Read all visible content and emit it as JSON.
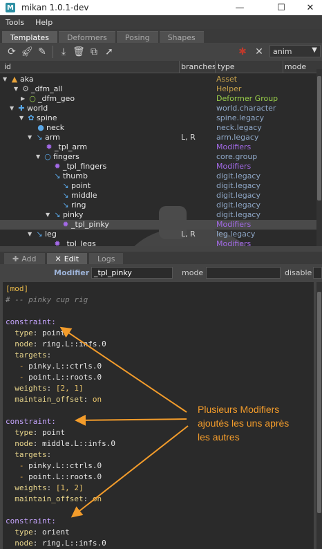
{
  "window": {
    "title": "mikan 1.0.1-dev",
    "minimize": "—",
    "maximize": "☐",
    "close": "✕",
    "app_icon": "M"
  },
  "menu": [
    "Tools",
    "Help"
  ],
  "tabs": [
    "Templates",
    "Deformers",
    "Posing",
    "Shapes"
  ],
  "toolbar": {
    "icons": [
      "refresh-icon",
      "rocket-icon",
      "brush-icon",
      "import-icon",
      "trash-icon",
      "duplicate-icon",
      "cursor-icon"
    ],
    "right_icons": [
      "bug-icon",
      "tools-icon"
    ],
    "mode_value": "anim"
  },
  "tree": {
    "columns": [
      "id",
      "branches",
      "type",
      "mode"
    ],
    "rows": [
      {
        "name": "aka",
        "branches": "",
        "type": "Asset",
        "icon": "▲",
        "icon_color": "#e8a33a",
        "type_color": "#c8a24a"
      },
      {
        "name": "_dfm_all",
        "branches": "",
        "type": "Helper",
        "icon": "⚙",
        "icon_color": "#bbbbbb",
        "type_color": "#c8a24a"
      },
      {
        "name": "_dfm_geo",
        "branches": "",
        "type": "Deformer Group",
        "icon": "○",
        "icon_color": "#9ad04a",
        "type_color": "#9ad04a"
      },
      {
        "name": "world",
        "branches": "",
        "type": "world.character",
        "icon": "✚",
        "icon_color": "#5aa8e8",
        "type_color": "#8fa8c8"
      },
      {
        "name": "spine",
        "branches": "",
        "type": "spine.legacy",
        "icon": "✿",
        "icon_color": "#5aa8e8",
        "type_color": "#8fa8c8"
      },
      {
        "name": "neck",
        "branches": "",
        "type": "neck.legacy",
        "icon": "●",
        "icon_color": "#5aa8e8",
        "type_color": "#8fa8c8"
      },
      {
        "name": "arm",
        "branches": "L, R",
        "type": "arm.legacy",
        "icon": "↘",
        "icon_color": "#5aa8e8",
        "type_color": "#8fa8c8"
      },
      {
        "name": "_tpl_arm",
        "branches": "",
        "type": "Modifiers",
        "icon": "✹",
        "icon_color": "#a46ae8",
        "type_color": "#a46ae8"
      },
      {
        "name": "fingers",
        "branches": "",
        "type": "core.group",
        "icon": "○",
        "icon_color": "#5aa8e8",
        "type_color": "#8fa8c8"
      },
      {
        "name": "_tpl_fingers",
        "branches": "",
        "type": "Modifiers",
        "icon": "✹",
        "icon_color": "#a46ae8",
        "type_color": "#a46ae8"
      },
      {
        "name": "thumb",
        "branches": "",
        "type": "digit.legacy",
        "icon": "↘",
        "icon_color": "#5aa8e8",
        "type_color": "#8fa8c8"
      },
      {
        "name": "point",
        "branches": "",
        "type": "digit.legacy",
        "icon": "↘",
        "icon_color": "#5aa8e8",
        "type_color": "#8fa8c8"
      },
      {
        "name": "middle",
        "branches": "",
        "type": "digit.legacy",
        "icon": "↘",
        "icon_color": "#5aa8e8",
        "type_color": "#8fa8c8"
      },
      {
        "name": "ring",
        "branches": "",
        "type": "digit.legacy",
        "icon": "↘",
        "icon_color": "#5aa8e8",
        "type_color": "#8fa8c8"
      },
      {
        "name": "pinky",
        "branches": "",
        "type": "digit.legacy",
        "icon": "↘",
        "icon_color": "#5aa8e8",
        "type_color": "#8fa8c8"
      },
      {
        "name": "_tpl_pinky",
        "branches": "",
        "type": "Modifiers",
        "icon": "✹",
        "icon_color": "#a46ae8",
        "type_color": "#a46ae8"
      },
      {
        "name": "leg",
        "branches": "L, R",
        "type": "leg.legacy",
        "icon": "↘",
        "icon_color": "#5aa8e8",
        "type_color": "#8fa8c8"
      },
      {
        "name": "_tpl_legs",
        "branches": "",
        "type": "Modifiers",
        "icon": "✹",
        "icon_color": "#a46ae8",
        "type_color": "#a46ae8"
      }
    ]
  },
  "bottom_tabs": [
    "Add",
    "Edit",
    "Logs"
  ],
  "modifier": {
    "label": "Modifier",
    "value": "_tpl_pinky",
    "mode_label": "mode",
    "mode_value": "",
    "disable_label": "disable"
  },
  "code": {
    "header": "[mod]",
    "comment": "# -- pinky cup rig",
    "constraint_key": "constraint:",
    "c1": {
      "type": "point",
      "node": "ring.L::infs.0",
      "t1": "pinky.L::ctrls.0",
      "t2": "point.L::roots.0",
      "weights": "[2, 1]",
      "offset": "on"
    },
    "c2": {
      "type": "point",
      "node": "middle.L::infs.0",
      "t1": "pinky.L::ctrls.0",
      "t2": "point.L::roots.0",
      "weights": "[1, 2]",
      "offset": "on"
    },
    "c3": {
      "type": "orient",
      "node": "ring.L::infs.0"
    }
  },
  "annotation": [
    "Plusieurs Modifiers",
    "ajoutés les uns après",
    "les autres"
  ]
}
